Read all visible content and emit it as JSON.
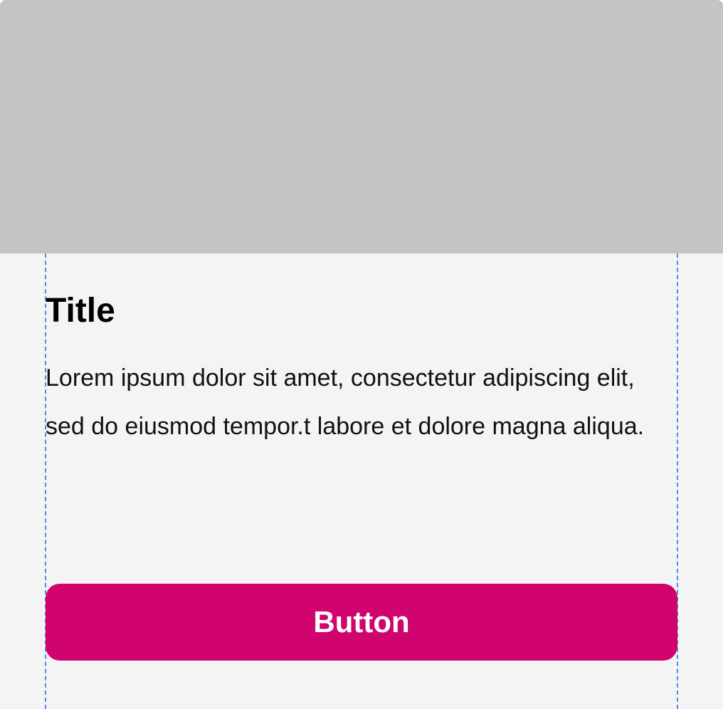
{
  "card": {
    "title": "Title",
    "body": "Lorem ipsum dolor sit amet, consectetur adipiscing elit, sed do eiusmod tempor.t labore et dolore magna aliqua.",
    "button_label": "Button"
  },
  "colors": {
    "media_placeholder": "#c4c4c4",
    "card_background": "#f4f4f4",
    "button_background": "#d1036e",
    "button_text": "#ffffff",
    "guide_lines": "#4a90e2"
  }
}
